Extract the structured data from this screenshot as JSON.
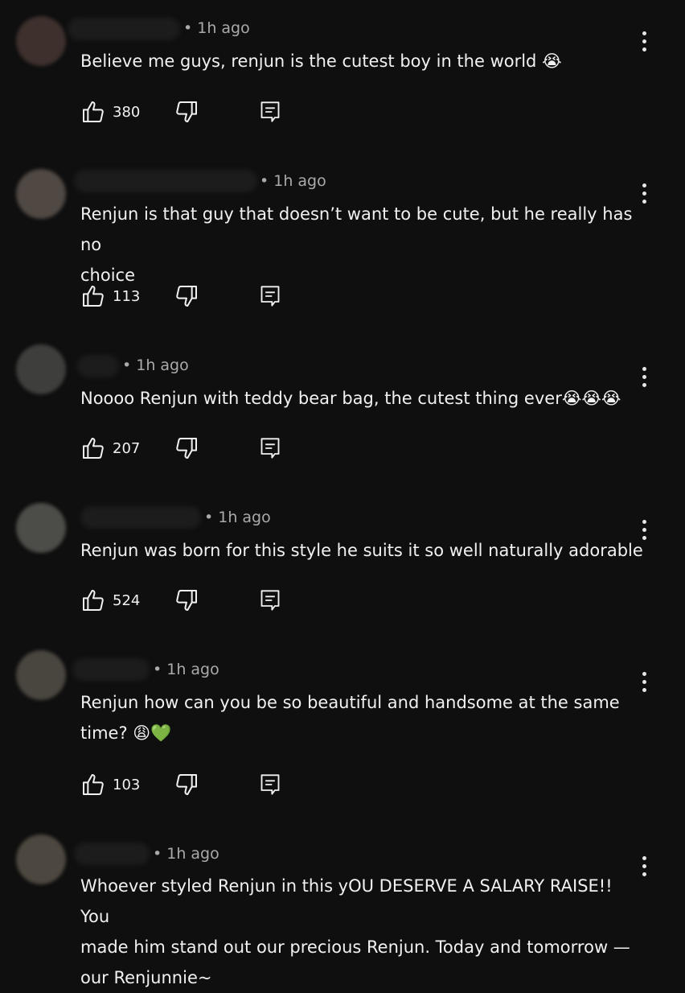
{
  "comments": [
    {
      "time": "• 1h ago",
      "text": "Believe me guys, renjun is the cutest boy in the world 😭",
      "likes": "380",
      "avatar_color": "#3d302d"
    },
    {
      "time": "• 1h ago",
      "text": "Renjun is that guy that doesn’t want to be cute, but he really has no\nchoice",
      "likes": "113",
      "avatar_color": "#4f4843"
    },
    {
      "time": "• 1h ago",
      "text": "Noooo Renjun with teddy bear bag, the cutest thing ever😭😭😭",
      "likes": "207",
      "avatar_color": "#3e3e3c"
    },
    {
      "time": "• 1h ago",
      "text": "Renjun was born for this style he suits it so well naturally adorable",
      "likes": "524",
      "avatar_color": "#4c4c48"
    },
    {
      "time": "• 1h ago",
      "text": "Renjun how can you be so beautiful and handsome at the same\ntime? 😩💚",
      "likes": "103",
      "avatar_color": "#49453f"
    },
    {
      "time": "• 1h ago",
      "text": "Whoever styled Renjun in this yOU DESERVE A SALARY RAISE!! You\nmade him stand out our precious Renjun. Today and tomorrow —\nour Renjunnie~",
      "likes": "",
      "avatar_color": "#4d483f"
    }
  ]
}
